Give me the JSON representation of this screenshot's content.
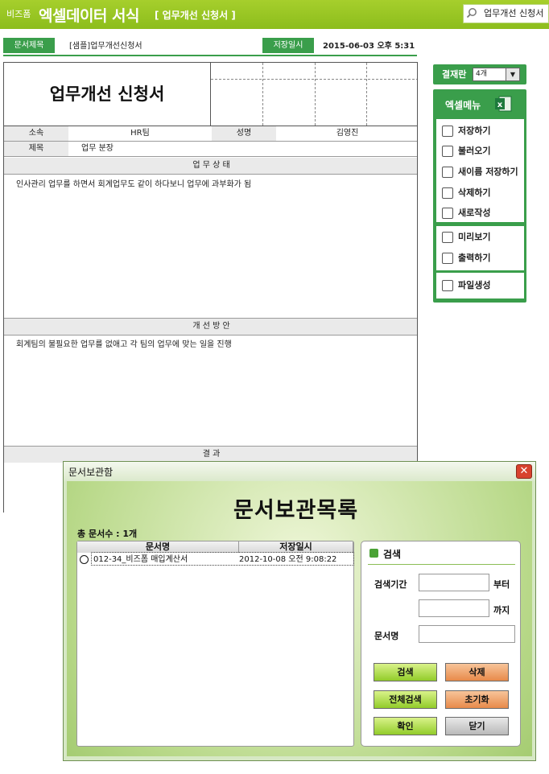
{
  "header": {
    "brand_small": "비즈폼",
    "title": "엑셀데이터 서식",
    "subtitle": "[ 업무개선 신청서 ]",
    "search_value": "업무개선 신청서"
  },
  "meta": {
    "doc_title_label": "문서제목",
    "doc_title_value": "[샘플]업무개선신청서",
    "saved_label": "저장일시",
    "saved_value": "2015-06-03  오후 5:31"
  },
  "document": {
    "title": "업무개선 신청서",
    "dept_label": "소속",
    "dept_value": "HR팀",
    "name_label": "성명",
    "name_value": "김영진",
    "subject_label": "제목",
    "subject_value": "업무 분장",
    "section1_title": "업 무 상 태",
    "section1_body": "인사관리 업무를 하면서 회계업무도 같이 하다보니 업무에 과부화가 됨",
    "section2_title": "개 선 방 안",
    "section2_body": "회계팀의 불필요한 업무를 없애고 각 팀의 업무에 맞는 일을 진행",
    "section3_title": "결 과"
  },
  "side": {
    "approval_label": "결재란",
    "approval_value": "4개",
    "menu_title": "엑셀메뉴",
    "items": [
      {
        "label": "저장하기",
        "icon": "save-icon"
      },
      {
        "label": "불러오기",
        "icon": "load-icon"
      },
      {
        "label": "새이름 저장하기",
        "icon": "save-as-icon"
      },
      {
        "label": "삭제하기",
        "icon": "trash-icon"
      },
      {
        "label": "새로작성",
        "icon": "new-doc-icon"
      },
      {
        "label": "미리보기",
        "icon": "monitor-icon"
      },
      {
        "label": "출력하기",
        "icon": "print-icon"
      },
      {
        "label": "파일생성",
        "icon": "folder-icon"
      }
    ]
  },
  "dialog": {
    "title": "문서보관함",
    "heading": "문서보관목록",
    "count_text": "총 문서수 : 1개",
    "col_name": "문서명",
    "col_date": "저장일시",
    "rows": [
      {
        "name": "012-34_비즈폼 매입계산서",
        "date": "2012-10-08 오전 9:08:22"
      }
    ],
    "search_title": "검색",
    "period_label": "검색기간",
    "from_label": "부터",
    "to_label": "까지",
    "docname_label": "문서명",
    "buttons": {
      "search": "검색",
      "delete": "삭제",
      "search_all": "전체검색",
      "reset": "초기화",
      "ok": "확인",
      "close": "닫기"
    }
  },
  "colors": {
    "header_green": "#98c624",
    "accent_green": "#3a9e4b",
    "close_red": "#d8422e"
  }
}
